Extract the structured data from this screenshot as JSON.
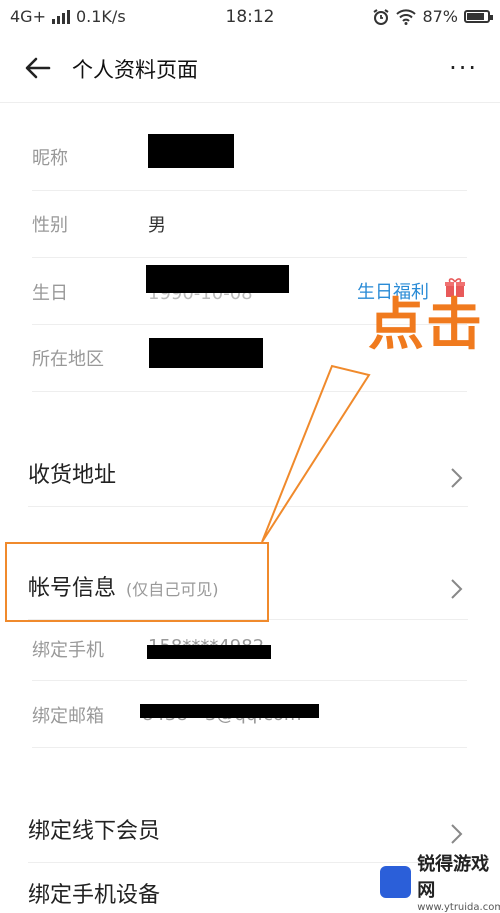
{
  "status_bar": {
    "network": "4G+",
    "speed": "0.1K/s",
    "time": "18:12",
    "battery": "87%",
    "battery_level": 0.87
  },
  "header": {
    "title": "个人资料页面",
    "more": "···"
  },
  "profile": {
    "nickname_label": "昵称",
    "gender_label": "性别",
    "gender_value": "男",
    "birthday_label": "生日",
    "birthday_partial": "1990-10-08",
    "birthday_promo": "生日福利",
    "region_label": "所在地区"
  },
  "shipping": {
    "label": "收货地址"
  },
  "account": {
    "label": "帐号信息",
    "hint": "(仅自己可见)",
    "phone_label": "绑定手机",
    "phone_value": "158****4982",
    "email_label": "绑定邮箱",
    "email_value": "8438···3@qq.com"
  },
  "offline": {
    "label": "绑定线下会员"
  },
  "device": {
    "label": "绑定手机设备"
  },
  "annotation": {
    "text": "点击",
    "color": "#f07a1e"
  },
  "watermark": {
    "name": "锐得游戏网",
    "url": "www.ytruida.com"
  },
  "colors": {
    "accent": "#2a8bd6",
    "annotation": "#f08a2c"
  }
}
